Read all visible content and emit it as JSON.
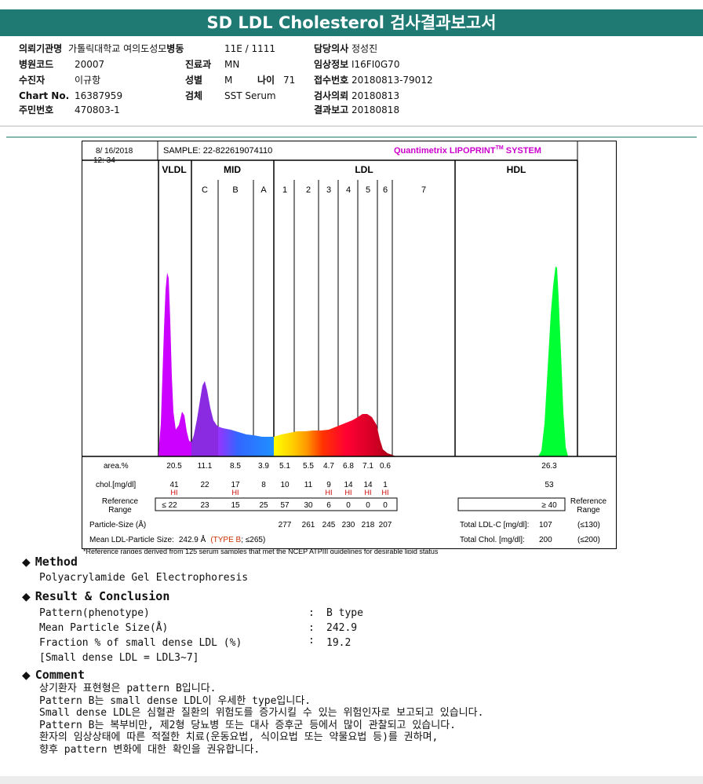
{
  "report": {
    "title": "SD LDL Cholesterol 검사결과보고서",
    "fields": {
      "inst_label": "의뢰기관명",
      "inst_value": "가톨릭대학교 여의도성모",
      "ward_label": "병동",
      "ward_value": "11E / 1111",
      "doctor_label": "담당의사",
      "doctor_value": "정성진",
      "hcode_label": "병원코드",
      "hcode_value": "20007",
      "dept_label": "진료과",
      "dept_value": "MN",
      "clin_label": "임상정보",
      "clin_value": "I16FI0G70",
      "patient_label": "수진자",
      "patient_value": "이규항",
      "sex_label": "성별",
      "sex_value": "M",
      "age_label": "나이",
      "age_value": "71",
      "recv_label": "접수번호",
      "recv_value": "20180813-79012",
      "chart_label": "Chart No.",
      "chart_value": "16387959",
      "specimen_label": "검체",
      "specimen_value": "SST Serum",
      "req_label": "검사의뢰",
      "req_value": "20180813",
      "rrn_label": "주민번호",
      "rrn_value": "470803-1",
      "result_label": "결과보고",
      "result_value": "20180818"
    }
  },
  "lipoprint": {
    "date": "8/ 16/2018",
    "time": "12: 34",
    "sample": "SAMPLE:  22-822619074110",
    "brand": "Quantimetrix LIPOPRINT",
    "brand_tm": "TM",
    "brand_suffix": " SYSTEM",
    "groups": [
      "VLDL",
      "MID",
      "LDL",
      "HDL"
    ],
    "subbands": [
      "C",
      "B",
      "A",
      "1",
      "2",
      "3",
      "4",
      "5",
      "6",
      "7"
    ],
    "area_label": "area.%",
    "area_values": [
      "20.5",
      "11.1",
      "8.5",
      "3.9",
      "5.1",
      "5.5",
      "4.7",
      "6.8",
      "7.1",
      "0.6"
    ],
    "area_hdl": "26.3",
    "chol_label": "chol.[mg/dl]",
    "chol_values": [
      "41",
      "22",
      "17",
      "8",
      "10",
      "11",
      "9",
      "14",
      "14",
      "1"
    ],
    "chol_hdl": "53",
    "hi_label": "HI",
    "ref_label_1": "Reference",
    "ref_label_2": "Range",
    "ref_values": [
      "≤  22",
      "23",
      "15",
      "25",
      "57",
      "30",
      "6",
      "0",
      "0",
      "0"
    ],
    "ref_hdl": "≥ 40",
    "particle_label": "Particle-Size (Å)",
    "particle_values": [
      "277",
      "261",
      "245",
      "230",
      "218",
      "207"
    ],
    "total_ldl_label": "Total LDL-C [mg/dl]:",
    "total_ldl_value": "107",
    "total_ldl_ref": "(≤130)",
    "mean_label": "Mean LDL-Particle Size:",
    "mean_value": "242.9 Å",
    "mean_type": "(TYPE B",
    "mean_ref": "; ≤265)",
    "total_chol_label": "Total Chol. [mg/dl]:",
    "total_chol_value": "200",
    "total_chol_ref": "(≤200)",
    "footnote": "*Reference ranges derived from 125 serum samples that met the NCEP ATPIII guidelines for desirable lipid status"
  },
  "method": {
    "heading": "Method",
    "text": "Polyacrylamide Gel Electrophoresis"
  },
  "result": {
    "heading": "Result & Conclusion",
    "rows": [
      {
        "label": "Pattern(phenotype)",
        "colon": ":",
        "value": "B type"
      },
      {
        "label": "Mean Particle Size(Å)",
        "colon": ":",
        "value": "242.9"
      },
      {
        "label": "Fraction % of small dense LDL (%)",
        "colon": ":",
        "value": "19.2"
      }
    ],
    "note": "[Small dense LDL = LDL3~7]"
  },
  "comment": {
    "heading": "Comment",
    "lines": [
      "상기환자 표현형은 pattern B입니다.",
      "Pattern B는 small dense LDL이 우세한 type입니다.",
      "Small dense LDL은 심혈관 질환의 위험도를 증가시킬 수 있는 위험인자로 보고되고 있습니다.",
      "Pattern B는 복부비만, 제2형 당뇨병 또는 대사 증후군 등에서 많이 관찰되고 있습니다.",
      "환자의 임상상태에 따른 적절한 치료(운동요법, 식이요법 또는 약물요법 등)를 권하며,",
      "향후 pattern 변화에 대한 확인을 권유합니다."
    ]
  }
}
